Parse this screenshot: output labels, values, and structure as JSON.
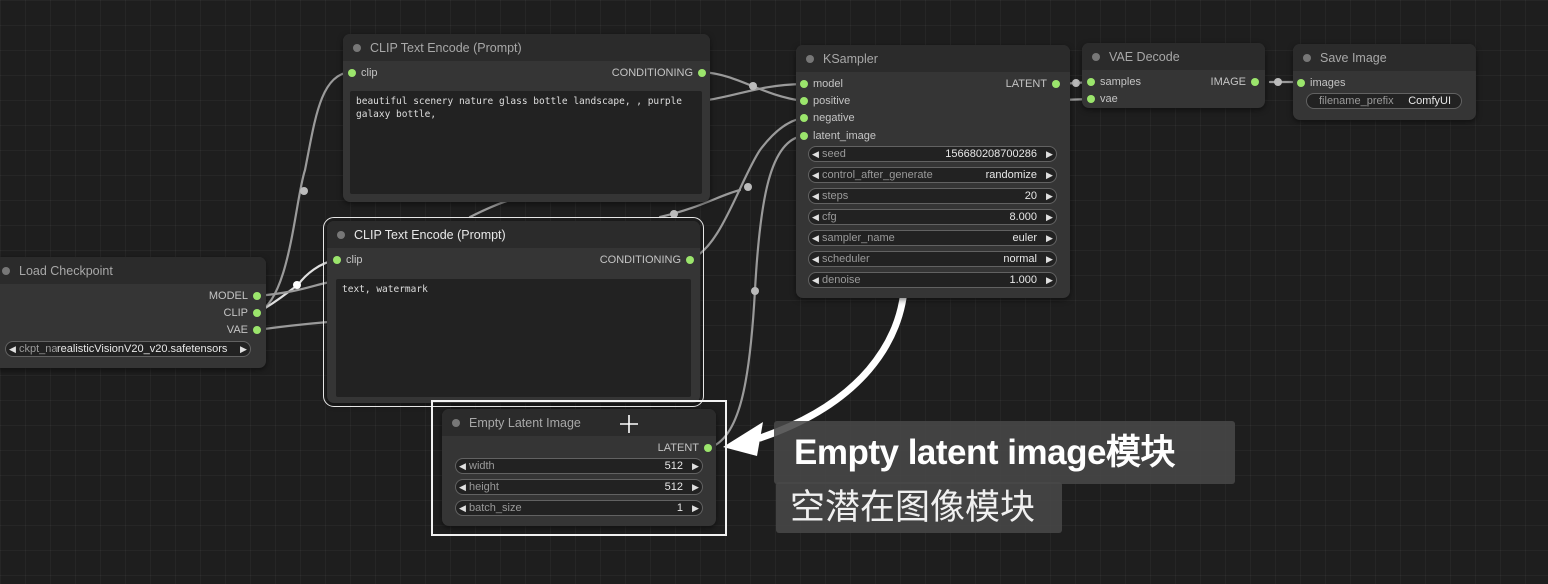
{
  "nodes": {
    "clip_pos": {
      "title": "CLIP Text Encode (Prompt)",
      "input": "clip",
      "output": "CONDITIONING",
      "text": "beautiful scenery nature glass bottle landscape, , purple galaxy bottle,"
    },
    "clip_neg": {
      "title": "CLIP Text Encode (Prompt)",
      "input": "clip",
      "output": "CONDITIONING",
      "text": "text, watermark"
    },
    "load_checkpoint": {
      "title": "Load Checkpoint",
      "outputs": [
        "MODEL",
        "CLIP",
        "VAE"
      ],
      "ckpt_label": "ckpt_name",
      "ckpt_value": "realisticVisionV20_v20.safetensors"
    },
    "ksampler": {
      "title": "KSampler",
      "inputs": [
        "model",
        "positive",
        "negative",
        "latent_image"
      ],
      "output": "LATENT",
      "widgets": [
        {
          "name": "seed",
          "value": "156680208700286"
        },
        {
          "name": "control_after_generate",
          "value": "randomize"
        },
        {
          "name": "steps",
          "value": "20"
        },
        {
          "name": "cfg",
          "value": "8.000"
        },
        {
          "name": "sampler_name",
          "value": "euler"
        },
        {
          "name": "scheduler",
          "value": "normal"
        },
        {
          "name": "denoise",
          "value": "1.000"
        }
      ]
    },
    "vae_decode": {
      "title": "VAE Decode",
      "inputs": [
        "samples",
        "vae"
      ],
      "output": "IMAGE"
    },
    "save_image": {
      "title": "Save Image",
      "input": "images",
      "widget_label": "filename_prefix",
      "widget_value": "ComfyUI"
    },
    "empty_latent": {
      "title": "Empty Latent Image",
      "output": "LATENT",
      "widgets": [
        {
          "name": "width",
          "value": "512"
        },
        {
          "name": "height",
          "value": "512"
        },
        {
          "name": "batch_size",
          "value": "1"
        }
      ]
    }
  },
  "captions": {
    "english": "Empty latent image模块",
    "chinese": "空潜在图像模块"
  },
  "colors": {
    "canvas": "#1e1e1e",
    "node_body": "#353535",
    "node_title": "#2b2b2b",
    "slot_dot": "#9be56c",
    "wire": "#9a9a9a",
    "highlight": "#f2f2f2"
  },
  "icons": {
    "arrow_left": "◀",
    "arrow_right": "▶"
  }
}
